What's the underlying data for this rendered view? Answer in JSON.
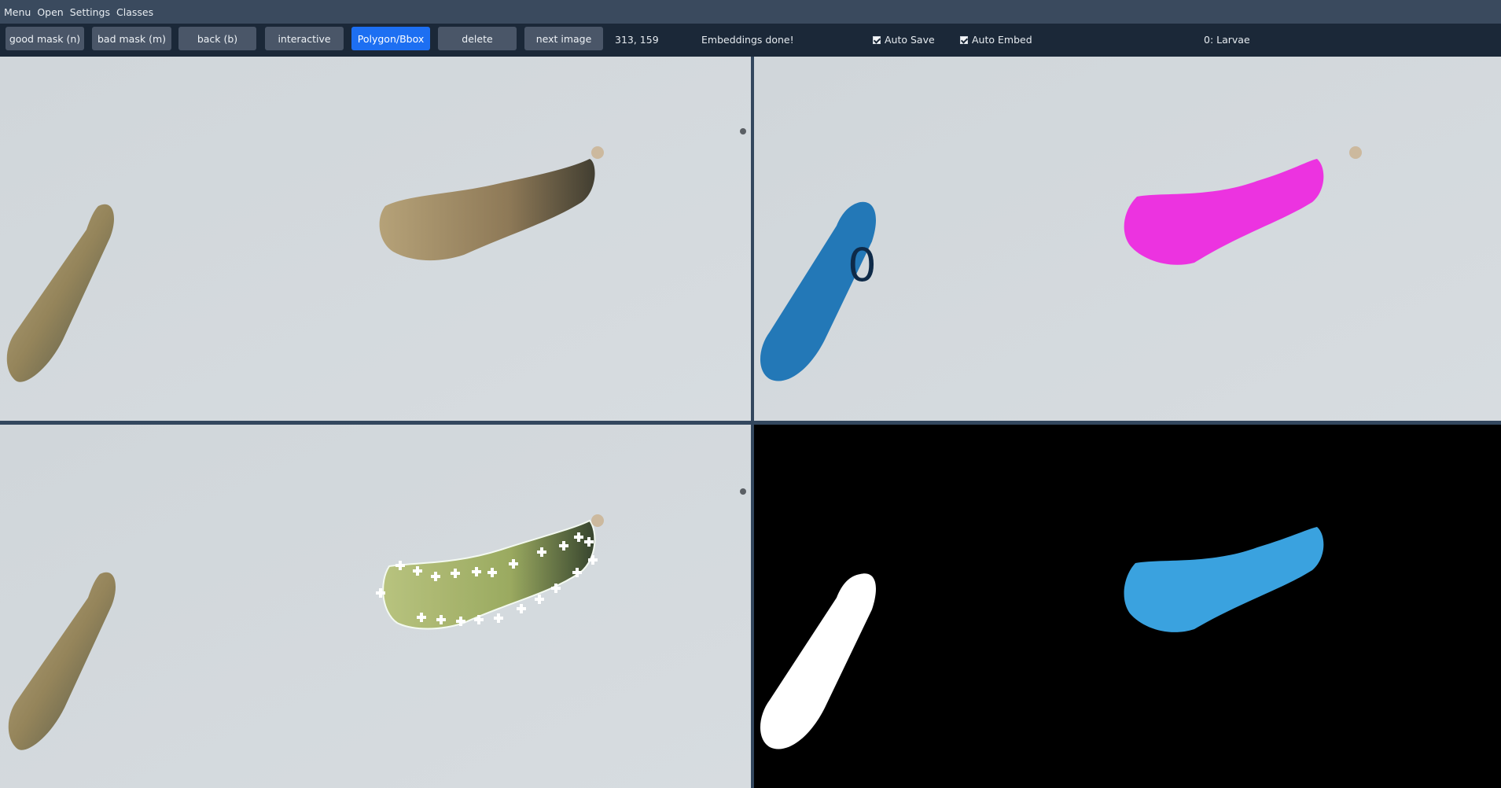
{
  "menu": {
    "items": [
      "Menu",
      "Open",
      "Settings",
      "Classes"
    ]
  },
  "toolbar": {
    "good_mask_label": "good mask (n)",
    "bad_mask_label": "bad mask (m)",
    "back_label": "back (b)",
    "interactive_label": "interactive",
    "polygon_label": "Polygon/Bbox",
    "delete_label": "delete",
    "next_image_label": "next image",
    "coordinates": "313, 159",
    "status": "Embeddings done!",
    "auto_save_label": "Auto Save",
    "auto_save_checked": true,
    "auto_embed_label": "Auto Embed",
    "auto_embed_checked": true,
    "current_class": "0: Larvae"
  },
  "panels": {
    "annotation_label": "0"
  },
  "colors": {
    "accent": "#1d6ff2",
    "mask_blue": "#2378b7",
    "mask_magenta": "#ec33e0",
    "mask_light_blue": "#3aa2df",
    "background_image": "#d3d8dc"
  }
}
